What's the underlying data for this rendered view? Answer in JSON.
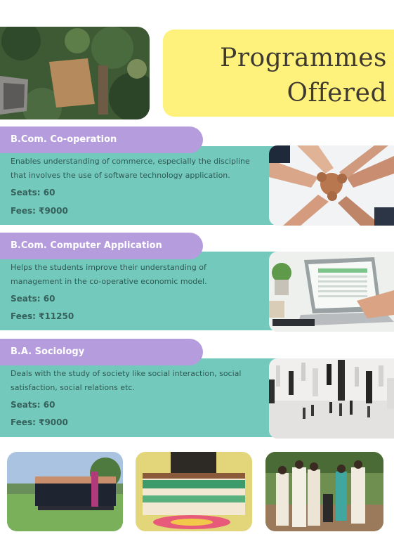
{
  "header": {
    "title_line1": "Programmes",
    "title_line2": "Offered"
  },
  "programmes": [
    {
      "name": "B.Com. Co-operation",
      "desc_line1": "Enables understanding of commerce, especially the discipline",
      "desc_line2": "that involves the use of software technology application.",
      "seats": "Seats: 60",
      "fees": "Fees: ₹9000",
      "photo": "puzzle-hands-photo"
    },
    {
      "name": "B.Com. Computer Application",
      "desc_line1": "Helps the students improve their understanding of",
      "desc_line2": "management in the co-operative economic model.",
      "seats": "Seats: 60",
      "fees": "Fees: ₹11250",
      "photo": "laptop-spreadsheet-photo"
    },
    {
      "name": "B.A. Sociology",
      "desc_line1": "Deals with the study of society like social interaction, social",
      "desc_line2": "satisfaction, social relations etc.",
      "seats": "Seats: 60",
      "fees": "Fees: ₹9000",
      "photo": "chess-figures-photo"
    }
  ],
  "colors": {
    "title_bg": "#fff27c",
    "band_bg": "#74c9bd",
    "tab_bg": "#b59ddd",
    "title_text": "#3f3a31"
  },
  "photos": [
    "campus-aerial-photo",
    "football-team-photo",
    "students-group-photo",
    "students-outdoor-photo"
  ]
}
